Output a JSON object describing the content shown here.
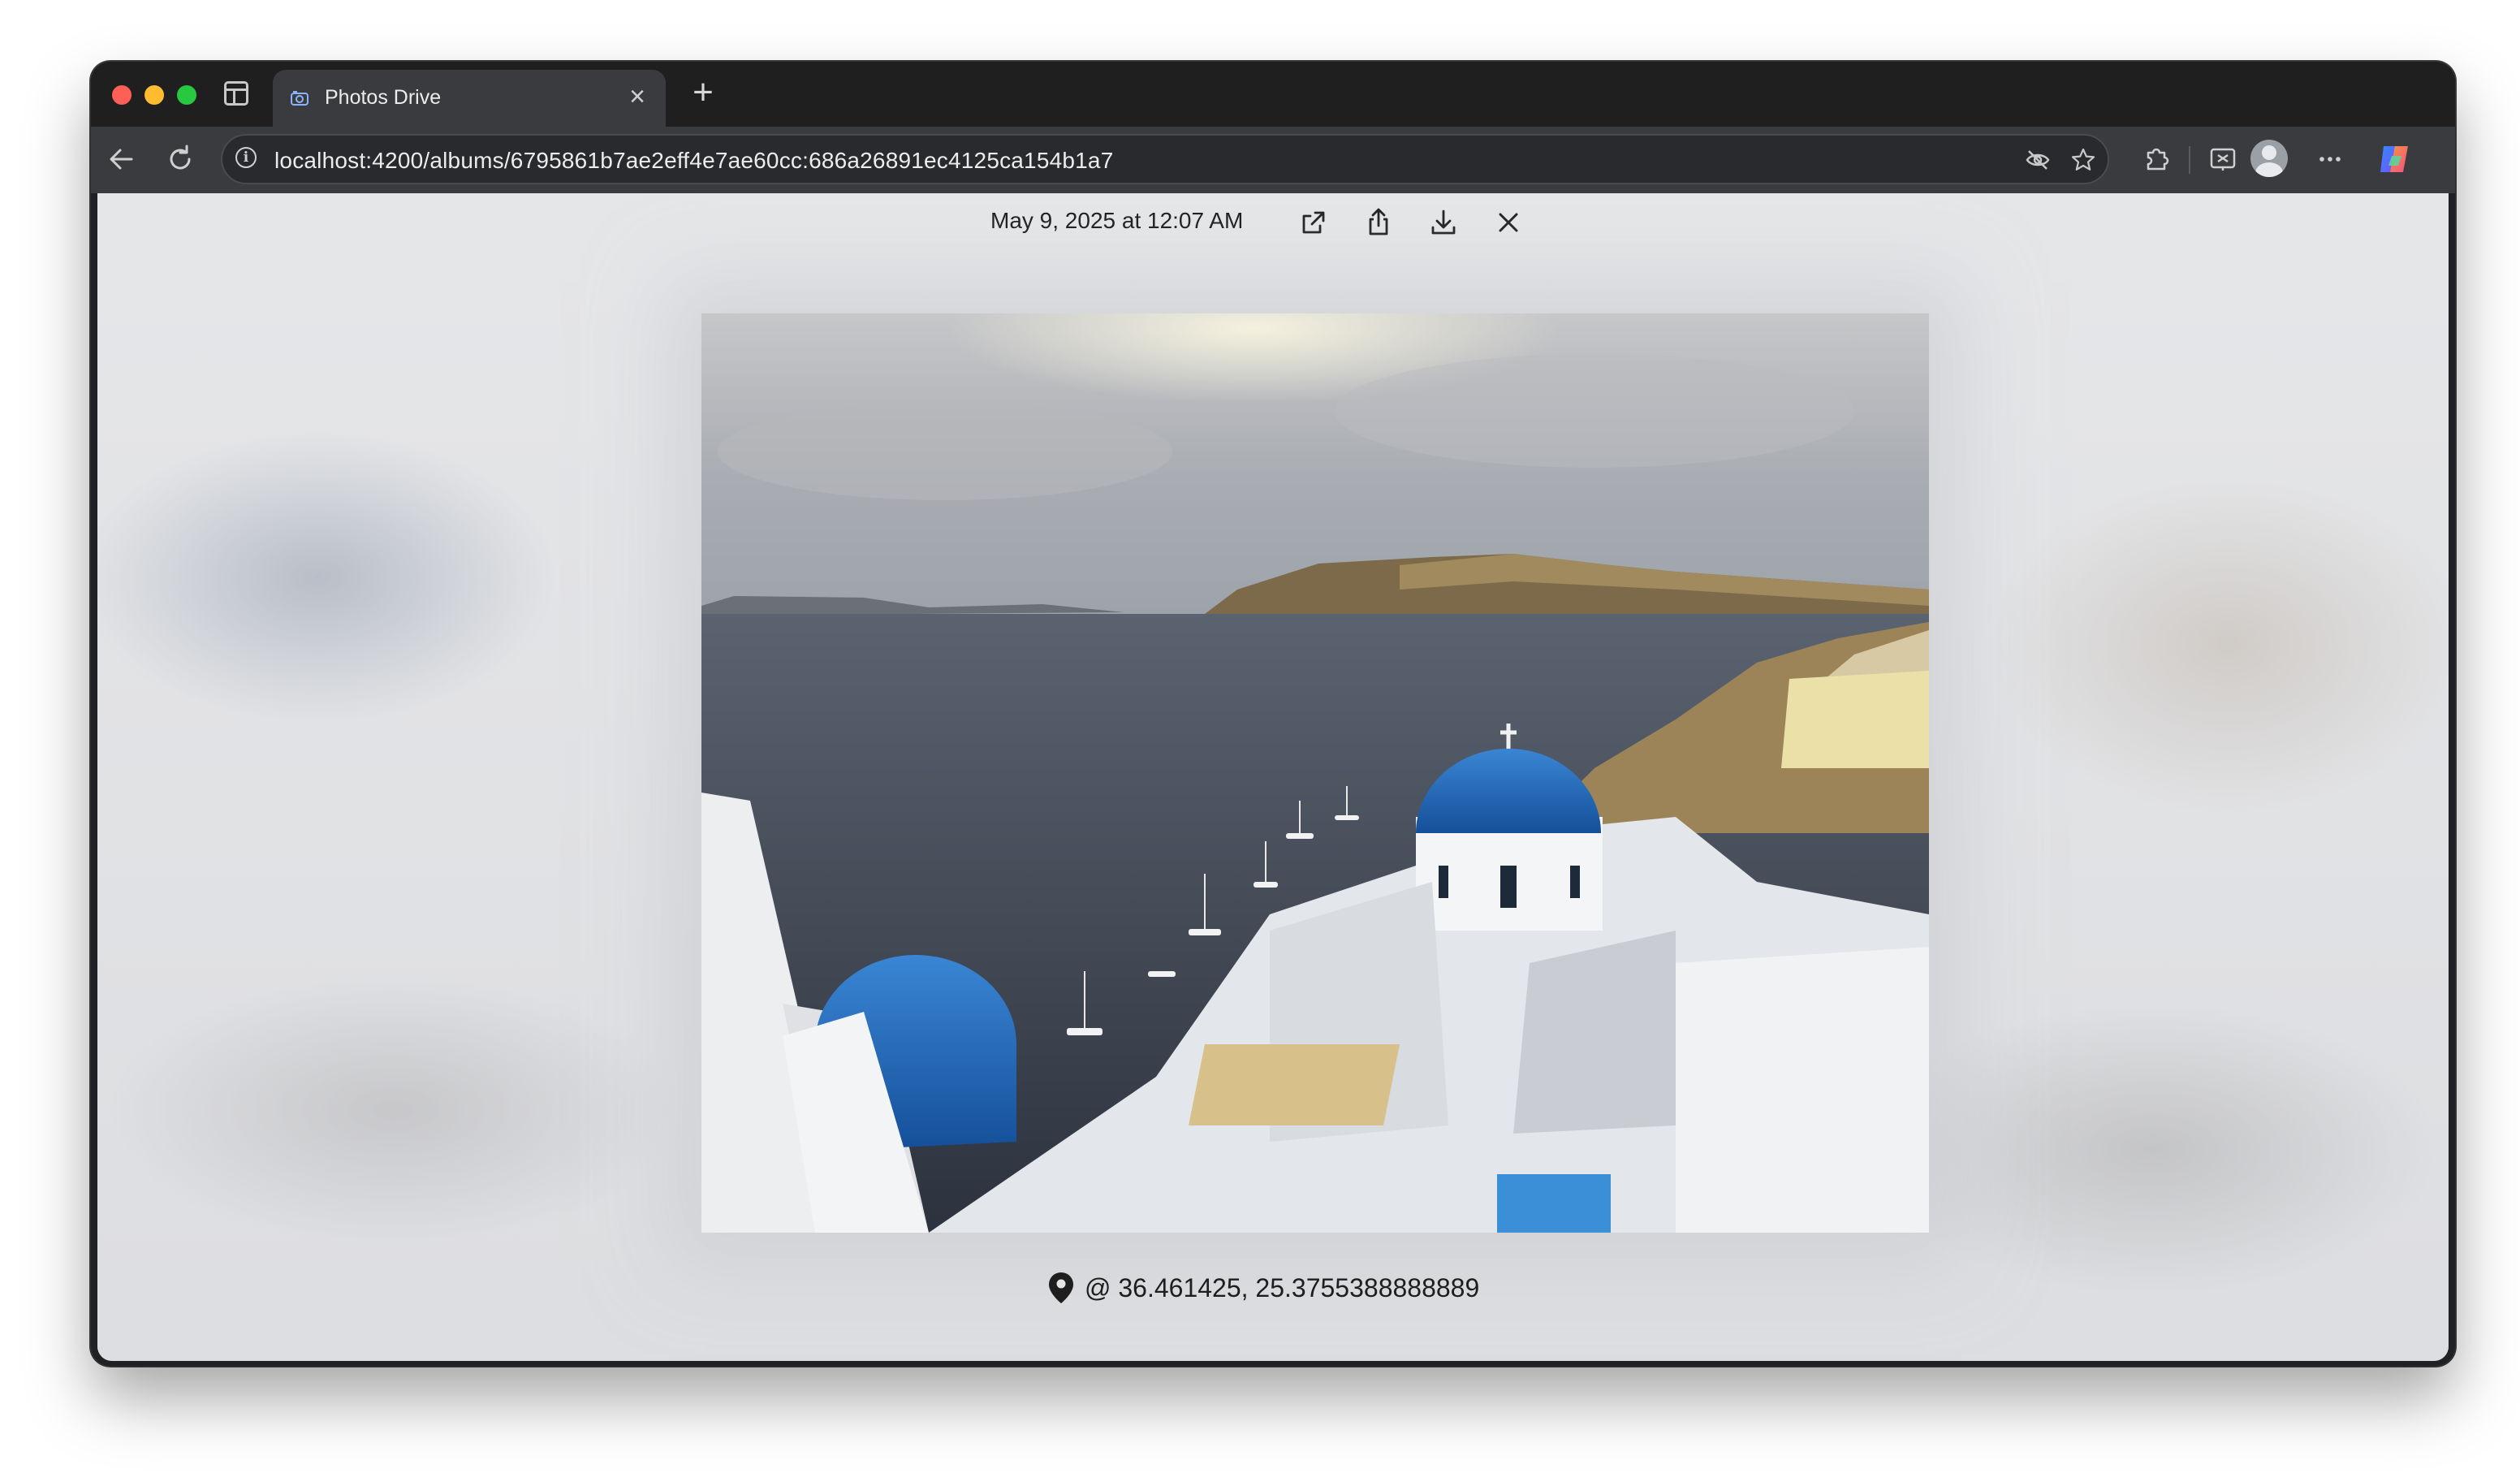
{
  "browser": {
    "tab": {
      "title": "Photos Drive"
    },
    "address_bar": {
      "url": "localhost:4200/albums/6795861b7ae2eff4e7ae60cc:686a26891ec4125ca154b1a7"
    }
  },
  "viewer": {
    "date_label": "May 9, 2025 at 12:07 AM",
    "actions": [
      "open-in-new",
      "share",
      "download",
      "close"
    ],
    "photo": {
      "subject": "white church with blue dome above sea cliffs"
    },
    "location": {
      "text": "@ 36.461425, 25.3755388888889"
    }
  },
  "colors": {
    "window_frame": "#202124",
    "toolbar": "#3a3b3e",
    "content_bg": "#e4e5e7",
    "dome_blue": "#1f64b0"
  }
}
